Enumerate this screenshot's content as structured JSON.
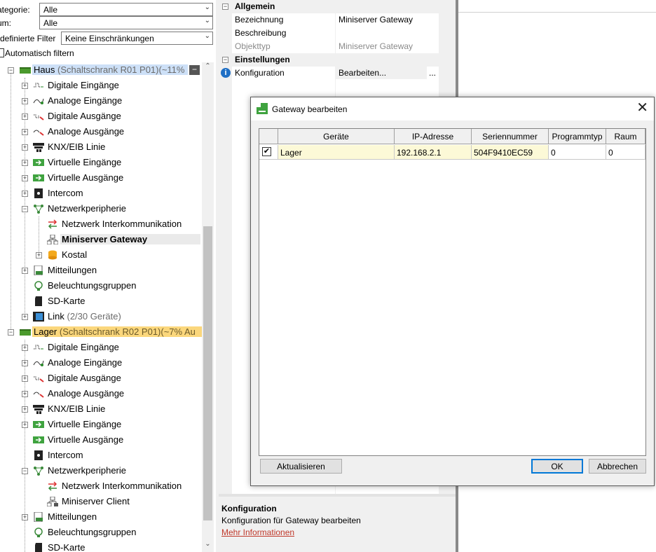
{
  "filters": {
    "kategorie_label": "ategorie:",
    "kategorie_value": "Alle",
    "raum_label": "um:",
    "raum_value": "Alle",
    "predefined_label": "rdefinierte Filter",
    "predefined_value": "Keine Einschränkungen",
    "autofilter_label": "Automatisch filtern"
  },
  "tree": {
    "haus": {
      "name": "Haus",
      "detail": "(Schaltschrank R01 P01)(~11%"
    },
    "haus_children": {
      "digitale_eingaenge": "Digitale Eingänge",
      "analoge_eingaenge": "Analoge Eingänge",
      "digitale_ausgaenge": "Digitale Ausgänge",
      "analoge_ausgaenge": "Analoge Ausgänge",
      "knx": "KNX/EIB Linie",
      "virt_eingaenge": "Virtuelle Eingänge",
      "virt_ausgaenge": "Virtuelle Ausgänge",
      "intercom": "Intercom",
      "netzwerk": "Netzwerkperipherie",
      "netz_interkomm": "Netzwerk Interkommunikation",
      "gateway": "Miniserver Gateway",
      "kostal": "Kostal",
      "mitteilungen": "Mitteilungen",
      "beleuchtung": "Beleuchtungsgruppen",
      "sd": "SD-Karte",
      "link": "Link",
      "link_detail": "(2/30 Geräte)"
    },
    "lager": {
      "name": "Lager",
      "detail": "(Schaltschrank R02 P01)(~7% Au"
    },
    "lager_children": {
      "digitale_eingaenge": "Digitale Eingänge",
      "analoge_eingaenge": "Analoge Eingänge",
      "digitale_ausgaenge": "Digitale Ausgänge",
      "analoge_ausgaenge": "Analoge Ausgänge",
      "knx": "KNX/EIB Linie",
      "virt_eingaenge": "Virtuelle Eingänge",
      "virt_ausgaenge": "Virtuelle Ausgänge",
      "intercom": "Intercom",
      "netzwerk": "Netzwerkperipherie",
      "netz_interkomm": "Netzwerk Interkommunikation",
      "client": "Miniserver Client",
      "mitteilungen": "Mitteilungen",
      "beleuchtung": "Beleuchtungsgruppen",
      "sd": "SD-Karte"
    }
  },
  "properties": {
    "cat_allgemein": "Allgemein",
    "bezeichnung_key": "Bezeichnung",
    "bezeichnung_val": "Miniserver Gateway",
    "beschreibung_key": "Beschreibung",
    "objekttyp_key": "Objekttyp",
    "objekttyp_val": "Miniserver Gateway",
    "cat_einstellungen": "Einstellungen",
    "konfig_key": "Konfiguration",
    "konfig_val": "Bearbeiten...",
    "konfig_dots": "..."
  },
  "description": {
    "title": "Konfiguration",
    "text": "Konfiguration für Gateway bearbeiten",
    "link": "Mehr Informationen"
  },
  "dialog": {
    "title": "Gateway bearbeiten",
    "close": "✕",
    "columns": [
      "Geräte",
      "IP-Adresse",
      "Seriennummer",
      "Programmtyp",
      "Raum"
    ],
    "row": {
      "checked": true,
      "geraet": "Lager",
      "ip": "192.168.2.1",
      "serial": "504F9410EC59",
      "programmtyp": "0",
      "raum": "0"
    },
    "refresh_button": "Aktualisieren",
    "ok_button": "OK",
    "cancel_button": "Abbrechen"
  },
  "colors": {
    "selection_blue": "#cde0f7",
    "selection_yellow": "#fbd77c",
    "accent": "#0078d7",
    "link": "#c0392b"
  }
}
